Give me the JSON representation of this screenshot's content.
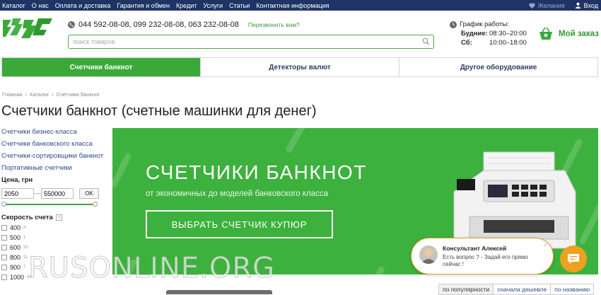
{
  "topnav": {
    "items": [
      "Каталог",
      "О нас",
      "Оплата и доставка",
      "Гарантия и обмен",
      "Кредит",
      "Услуги",
      "Статьи",
      "Контактная информация"
    ],
    "wishlist": "Желания",
    "login": "Вход"
  },
  "header": {
    "phones": "044 592-08-08,  099 232-08-08,  063 232-08-08",
    "callback": "Перезвонить вам?",
    "search_placeholder": "поиск товаров",
    "schedule_title": "График работы:",
    "schedule": [
      {
        "day": "Будние:",
        "hours": "08:30–20:00"
      },
      {
        "day": "Сб:",
        "hours": "10:00–18:00"
      }
    ],
    "cart": "Мой заказ"
  },
  "tabs": [
    "Счетчики банкнот",
    "Детекторы валют",
    "Другое оборудование"
  ],
  "breadcrumbs": [
    "Главная",
    "Каталог",
    "Счетчики банкнот"
  ],
  "page_title": "Счетчики банкнот (счетные машинки для денег)",
  "sidebar": {
    "links": [
      "Счетчики бизнес-класса",
      "Счетчики банковского класса",
      "Счетчики-сортировщики банкнот",
      "Портативные счетчики"
    ],
    "price_label": "Цена, грн",
    "price_min": "2050",
    "price_max": "550000",
    "ok": "OK",
    "price_range_fraction": [
      0.0,
      1.0
    ],
    "speed_label": "Скорость счета",
    "speed_options": [
      {
        "label": "400",
        "count": "4"
      },
      {
        "label": "500",
        "count": "1"
      },
      {
        "label": "600",
        "count": "20"
      },
      {
        "label": "800",
        "count": "11"
      },
      {
        "label": "900",
        "count": "7"
      },
      {
        "label": "1000",
        "count": "44"
      }
    ]
  },
  "banner": {
    "title": "СЧЕТЧИКИ БАНКНОТ",
    "subtitle": "от экономичных до моделей банковского класса",
    "button": "ВЫБРАТЬ СЧЕТЧИК КУПЮР",
    "color": "#3db13d"
  },
  "consultant": {
    "name": "Консультант Алексей",
    "message": "Есть вопрос ? - Задай его прямо сейчас !"
  },
  "sort": [
    "по популярности",
    "сначала дешевле",
    "по названию"
  ],
  "watermark": "RUSONLINE.ORG",
  "colors": {
    "accent": "#3aa93a",
    "topbar": "#1f3364",
    "chat": "#f0a020"
  }
}
